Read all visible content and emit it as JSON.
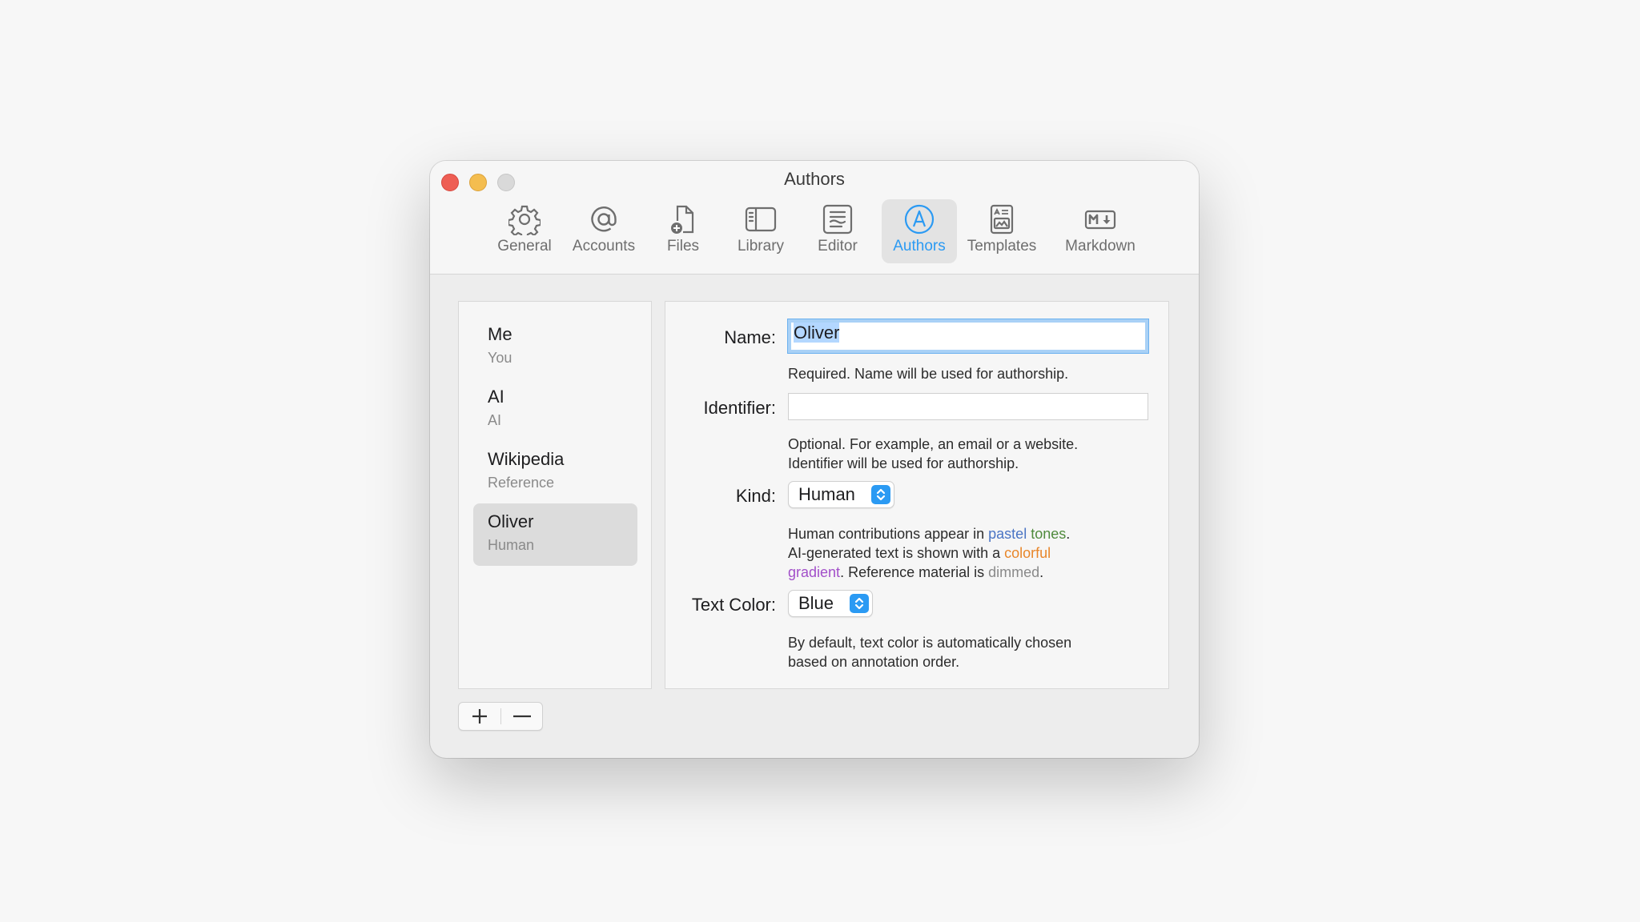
{
  "window": {
    "title": "Authors"
  },
  "tabs": [
    {
      "label": "General",
      "icon": "gear-icon"
    },
    {
      "label": "Accounts",
      "icon": "at-icon"
    },
    {
      "label": "Files",
      "icon": "file-add-icon"
    },
    {
      "label": "Library",
      "icon": "sidebar-icon"
    },
    {
      "label": "Editor",
      "icon": "editor-icon"
    },
    {
      "label": "Authors",
      "icon": "author-icon",
      "active": true
    },
    {
      "label": "Templates",
      "icon": "template-icon"
    },
    {
      "label": "Markdown",
      "icon": "markdown-icon"
    }
  ],
  "authors": [
    {
      "name": "Me",
      "kind": "You"
    },
    {
      "name": "AI",
      "kind": "AI"
    },
    {
      "name": "Wikipedia",
      "kind": "Reference"
    },
    {
      "name": "Oliver",
      "kind": "Human",
      "selected": true
    }
  ],
  "form": {
    "name_label": "Name:",
    "name_value": "Oliver",
    "name_hint": "Required. Name will be used for authorship.",
    "identifier_label": "Identifier:",
    "identifier_value": "",
    "identifier_hint_1": "Optional. For example, an email or a website.",
    "identifier_hint_2": "Identifier will be used for authorship.",
    "kind_label": "Kind:",
    "kind_value": "Human",
    "kind_hint": {
      "p1": "Human contributions appear in ",
      "pastel": "pastel",
      "space": " ",
      "tones": "tones",
      "p2": ".",
      "p3": "AI-generated text is shown with a ",
      "colorful": "colorful",
      "gradient": "gradient",
      "p4": ". Reference material is ",
      "dimmed": "dimmed",
      "p5": "."
    },
    "textcolor_label": "Text Color:",
    "textcolor_value": "Blue",
    "textcolor_hint_1": "By default, text color is automatically chosen",
    "textcolor_hint_2": "based on annotation order."
  },
  "buttons": {
    "add": "add-icon",
    "remove": "remove-icon"
  },
  "colors": {
    "accent": "#2b9af3",
    "pastel": "#4a74c4",
    "tones": "#4f8a3c",
    "colorful": "#e8862a",
    "gradient": "#a24fc9",
    "dimmed": "#8a8a8a"
  }
}
